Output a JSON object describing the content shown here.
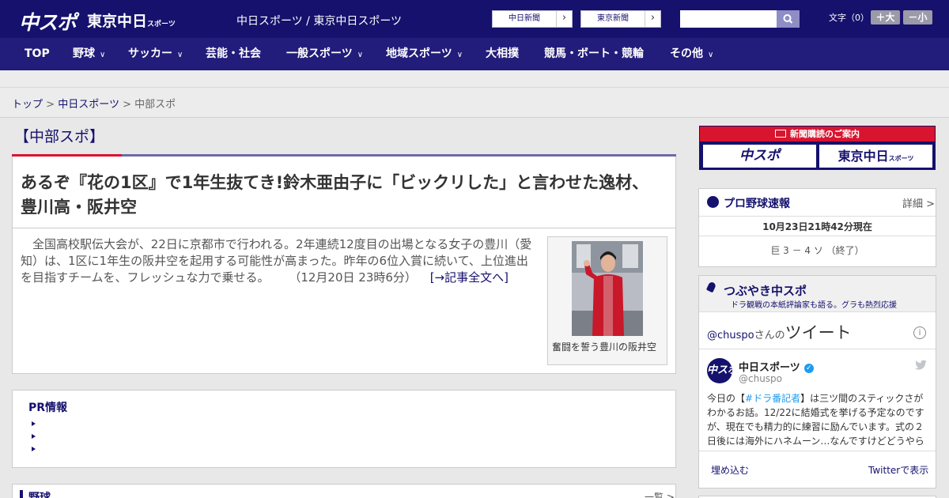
{
  "header": {
    "logo_primary": "中スポ",
    "logo_secondary": "東京中日",
    "logo_secondary_small": "スポーツ",
    "site_title": "中日スポーツ / 東京中日スポーツ",
    "links": [
      {
        "label": "中日新聞",
        "arrow": "›"
      },
      {
        "label": "東京新聞",
        "arrow": "›"
      }
    ],
    "search_placeholder": "",
    "font_size_label": "文字（0）",
    "font_larger": "＋大",
    "font_smaller": "－小"
  },
  "nav": {
    "items": [
      {
        "label": "TOP",
        "chevron": ""
      },
      {
        "label": "野球",
        "chevron": "∨"
      },
      {
        "label": "サッカー",
        "chevron": "∨"
      },
      {
        "label": "芸能・社会",
        "chevron": ""
      },
      {
        "label": "一般スポーツ",
        "chevron": "∨"
      },
      {
        "label": "地域スポーツ",
        "chevron": "∨"
      },
      {
        "label": "大相撲",
        "chevron": ""
      },
      {
        "label": "競馬・ボート・競輪",
        "chevron": ""
      },
      {
        "label": "その他",
        "chevron": "∨"
      }
    ]
  },
  "breadcrumb": {
    "items": [
      "トップ",
      "中日スポーツ",
      "中部スポ"
    ],
    "separator": ">"
  },
  "section": {
    "title": "【中部スポ】"
  },
  "article": {
    "title": "あるぞ『花の1区』で1年生抜てき!鈴木亜由子に「ビックリした」と言わせた逸材、豊川高・阪井空",
    "body": "　全国高校駅伝大会が、22日に京都市で行われる。2年連続12度目の出場となる女子の豊川（愛知）は、1区に1年生の阪井空を起用する可能性が高まった。昨年の6位入賞に続いて、上位進出を目指すチームを、フレッシュな力で乗せる。",
    "timestamp": "（12月20日 23時6分）",
    "more_link": "[→記事全文へ]",
    "photo_caption": "奮闘を誓う豊川の阪井空"
  },
  "pr": {
    "title": "PR情報",
    "items": [
      "",
      "",
      ""
    ]
  },
  "yakyu": {
    "title": "野球",
    "more": "一覧 >"
  },
  "sidebar": {
    "subscribe": {
      "title": "新聞購読のご案内",
      "logo1": "中スポ",
      "logo2": "東京中日",
      "logo2_small": "スポーツ"
    },
    "baseball": {
      "title": "プロ野球速報",
      "detail": "詳細 >",
      "time": "10月23日21時42分現在",
      "score": "巨 3 － 4 ソ （終了）"
    },
    "tsubuyaki": {
      "title": "つぶやき中スポ",
      "subtitle": "ドラ観戦の本紙評論家も語る。グラも熱烈応援",
      "handle_line": "@chuspo",
      "handle_suffix": "さんの",
      "tweets_label": "ツイート",
      "info": "i",
      "account_name": "中日スポーツ",
      "verified": "✓",
      "account_handle": "@chuspo",
      "avatar_text": "中スポ",
      "bird": "🐦",
      "tweet_prefix": "今日の【",
      "tweet_tag": "#ドラ番記者",
      "tweet_body": "】は三ツ間のスティックさがわかるお話。12/22に結婚式を挙げる予定なのですが、現在でも精力的に練習に励んでいます。式の２日後には海外にハネムーン…なんですけどどうやら",
      "embed": "埋め込む",
      "view_on_twitter": "Twitterで表示"
    }
  },
  "colors": {
    "brand_navy": "#15116d",
    "nav_bg": "#221c7a",
    "accent_red": "#d9142f",
    "link_blue": "#1d9bf0"
  }
}
